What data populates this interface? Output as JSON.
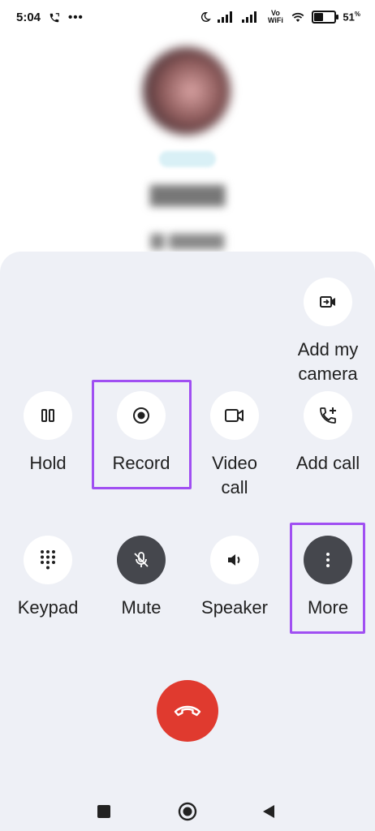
{
  "status_bar": {
    "time": "5:04",
    "network_label": "Vo WiFi",
    "battery_percent": 51,
    "battery_label": "51",
    "icons": [
      "phone-call-icon",
      "more-dots-icon",
      "moon-icon",
      "signal-icon",
      "wifi-icon",
      "battery-icon"
    ]
  },
  "controls": {
    "add_camera": {
      "label": "Add my\ncamera",
      "icon": "camera-add-icon"
    },
    "hold": {
      "label": "Hold",
      "icon": "pause-icon"
    },
    "record": {
      "label": "Record",
      "icon": "record-icon"
    },
    "video_call": {
      "label": "Video\ncall",
      "icon": "video-icon"
    },
    "add_call": {
      "label": "Add call",
      "icon": "add-call-icon"
    },
    "keypad": {
      "label": "Keypad",
      "icon": "dialpad-icon"
    },
    "mute": {
      "label": "Mute",
      "icon": "mic-off-icon",
      "active": true
    },
    "speaker": {
      "label": "Speaker",
      "icon": "speaker-icon"
    },
    "more": {
      "label": "More",
      "icon": "more-vert-icon",
      "active": true
    }
  },
  "end_call": {
    "icon": "call-end-icon"
  },
  "nav_bar": {
    "icons": [
      "recents-square-icon",
      "home-circle-icon",
      "back-triangle-icon"
    ]
  },
  "colors": {
    "panel_bg": "#eef0f6",
    "highlight": "#a04ff2",
    "end_call": "#e03a2f",
    "active_control": "#45474d"
  }
}
